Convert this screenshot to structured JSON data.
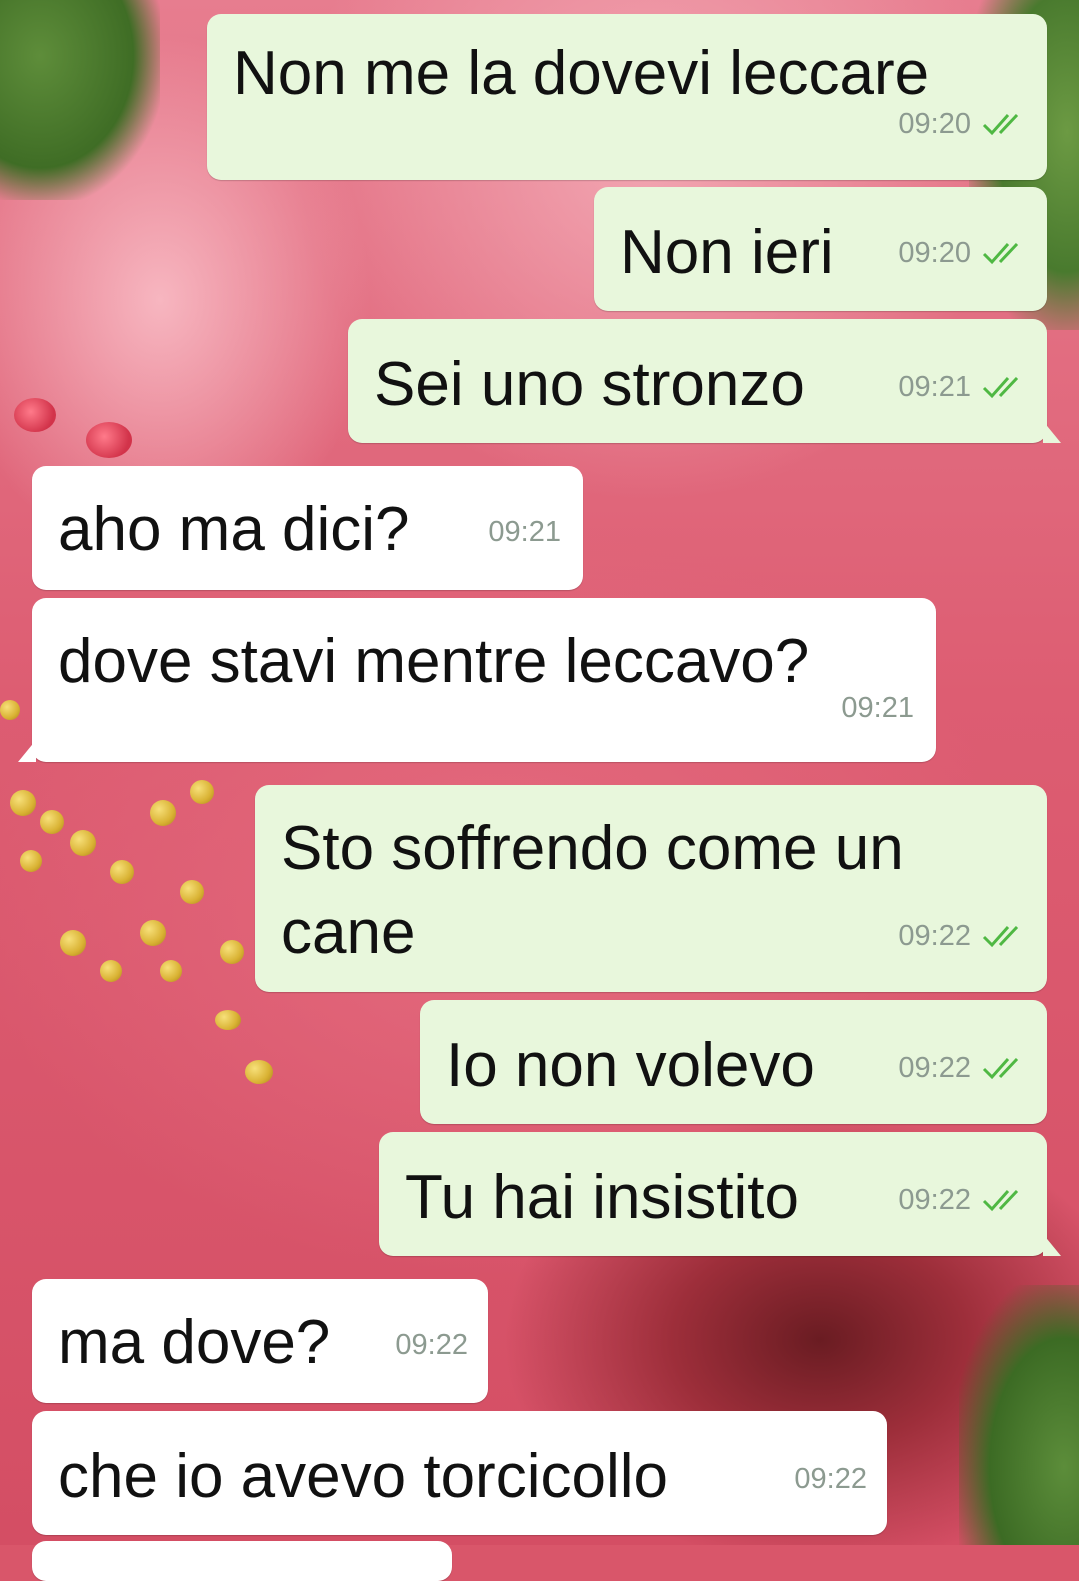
{
  "chat": {
    "messages": [
      {
        "direction": "outgoing",
        "text": "Non me la dovevi leccare",
        "time": "09:20",
        "status": "read"
      },
      {
        "direction": "outgoing",
        "text": "Non ieri",
        "time": "09:20",
        "status": "read"
      },
      {
        "direction": "outgoing",
        "text": "Sei uno stronzo",
        "time": "09:21",
        "status": "read"
      },
      {
        "direction": "incoming",
        "text": "aho ma dici?",
        "time": "09:21"
      },
      {
        "direction": "incoming",
        "text": "dove stavi mentre leccavo?",
        "time": "09:21"
      },
      {
        "direction": "outgoing",
        "text_line1": "Sto soffrendo come un",
        "text_line2": "cane",
        "time": "09:22",
        "status": "read"
      },
      {
        "direction": "outgoing",
        "text": "Io non volevo",
        "time": "09:22",
        "status": "read"
      },
      {
        "direction": "outgoing",
        "text": "Tu hai insistito",
        "time": "09:22",
        "status": "read"
      },
      {
        "direction": "incoming",
        "text": "ma dove?",
        "time": "09:22"
      },
      {
        "direction": "incoming",
        "text": "che io avevo torcicollo",
        "time": "09:22"
      }
    ]
  },
  "icons": {
    "read_receipt": "double-check-icon"
  },
  "colors": {
    "outgoing_bubble": "#e8f7dc",
    "incoming_bubble": "#ffffff",
    "timestamp": "#8c9a90",
    "read_receipt": "#4fb843"
  }
}
